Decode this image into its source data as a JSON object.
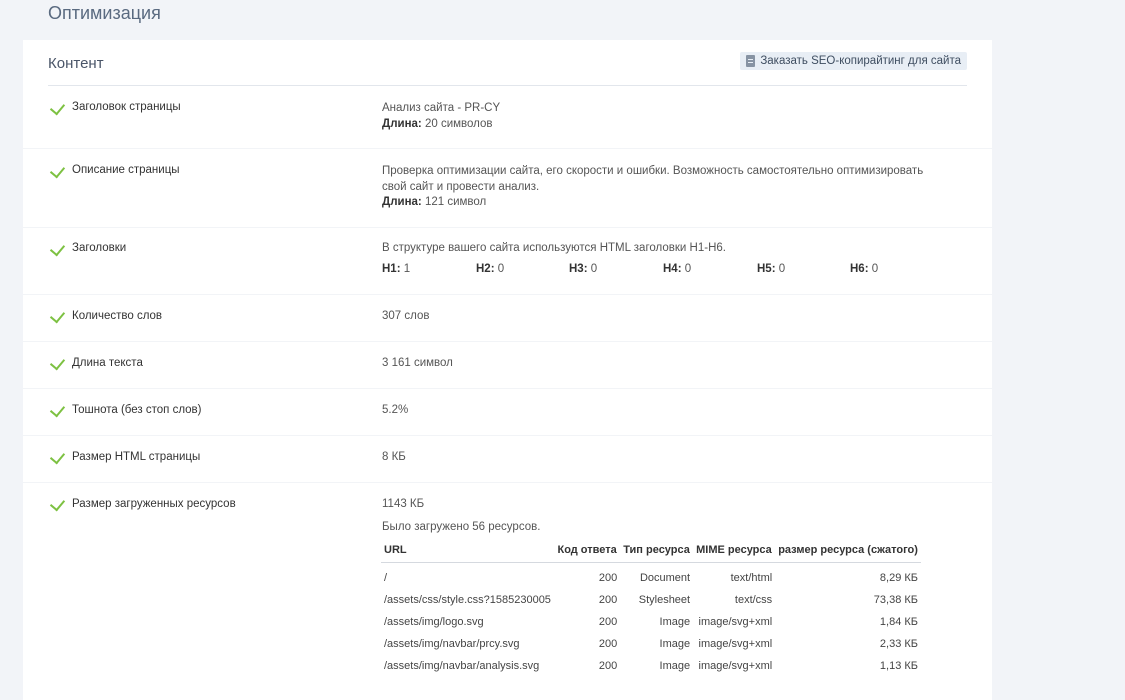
{
  "page": {
    "title": "Оптимизация"
  },
  "section": {
    "title": "Контент",
    "order_link": "Заказать SEO-копирайтинг для сайта",
    "order_icon": "document-icon"
  },
  "colors": {
    "check": "#7dc142",
    "title": "#5a6a80"
  },
  "rows": {
    "page_title": {
      "label": "Заголовок страницы",
      "value": "Анализ сайта - PR-CY",
      "length_label": "Длина:",
      "length_value": "20 символов"
    },
    "page_description": {
      "label": "Описание страницы",
      "value": "Проверка оптимизации сайта, его скорости и ошибки. Возможность самостоятельно оптимизировать свой сайт и провести анализ.",
      "length_label": "Длина:",
      "length_value": "121 символ"
    },
    "headings": {
      "label": "Заголовки",
      "value": "В структуре вашего сайта используются HTML заголовки H1-H6.",
      "items": [
        {
          "tag": "H1:",
          "count": "1"
        },
        {
          "tag": "H2:",
          "count": "0"
        },
        {
          "tag": "H3:",
          "count": "0"
        },
        {
          "tag": "H4:",
          "count": "0"
        },
        {
          "tag": "H5:",
          "count": "0"
        },
        {
          "tag": "H6:",
          "count": "0"
        }
      ]
    },
    "word_count": {
      "label": "Количество слов",
      "value": "307 слов"
    },
    "text_length": {
      "label": "Длина текста",
      "value": "3 161 символ"
    },
    "nausea": {
      "label": "Тошнота (без стоп слов)",
      "value": "5.2%"
    },
    "html_size": {
      "label": "Размер HTML страницы",
      "value": "8 КБ"
    },
    "resources": {
      "label": "Размер загруженных ресурсов",
      "value": "1143 КБ",
      "loaded": "Было загружено 56 ресурсов.",
      "columns": [
        "URL",
        "Код ответа",
        "Тип ресурса",
        "MIME ресурса",
        "размер ресурса (сжатого)"
      ],
      "items": [
        {
          "url": "/",
          "code": "200",
          "type": "Document",
          "mime": "text/html",
          "size": "8,29 КБ"
        },
        {
          "url": "/assets/css/style.css?1585230005",
          "code": "200",
          "type": "Stylesheet",
          "mime": "text/css",
          "size": "73,38 КБ"
        },
        {
          "url": "/assets/img/logo.svg",
          "code": "200",
          "type": "Image",
          "mime": "image/svg+xml",
          "size": "1,84 КБ"
        },
        {
          "url": "/assets/img/navbar/prcy.svg",
          "code": "200",
          "type": "Image",
          "mime": "image/svg+xml",
          "size": "2,33 КБ"
        },
        {
          "url": "/assets/img/navbar/analysis.svg",
          "code": "200",
          "type": "Image",
          "mime": "image/svg+xml",
          "size": "1,13 КБ"
        }
      ]
    }
  }
}
